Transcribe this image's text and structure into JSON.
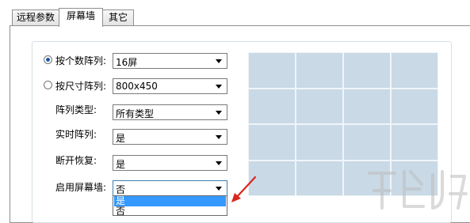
{
  "tabs": [
    {
      "label": "远程参数",
      "active": false
    },
    {
      "label": "屏幕墙",
      "active": true
    },
    {
      "label": "其它",
      "active": false
    }
  ],
  "layout_mode": {
    "by_count": {
      "label": "按个数阵列:",
      "selected": true,
      "value": "16屏"
    },
    "by_size": {
      "label": "按尺寸阵列:",
      "selected": false,
      "value": "800x450"
    }
  },
  "fields": {
    "array_type": {
      "label": "阵列类型:",
      "value": "所有类型"
    },
    "realtime_array": {
      "label": "实时阵列:",
      "value": "是"
    },
    "reconnect": {
      "label": "断开恢复:",
      "value": "是"
    },
    "enable_wall": {
      "label": "启用屏幕墙:",
      "value": "否"
    }
  },
  "dropdown_options": [
    "是",
    "否"
  ],
  "dropdown_selected": "是",
  "preview_grid": {
    "rows": 4,
    "cols": 4
  },
  "colors": {
    "preview_bg": "#c9d9e6",
    "selection": "#3399ff",
    "arrow": "#d9261c",
    "watermark": "#c8c8c8"
  }
}
